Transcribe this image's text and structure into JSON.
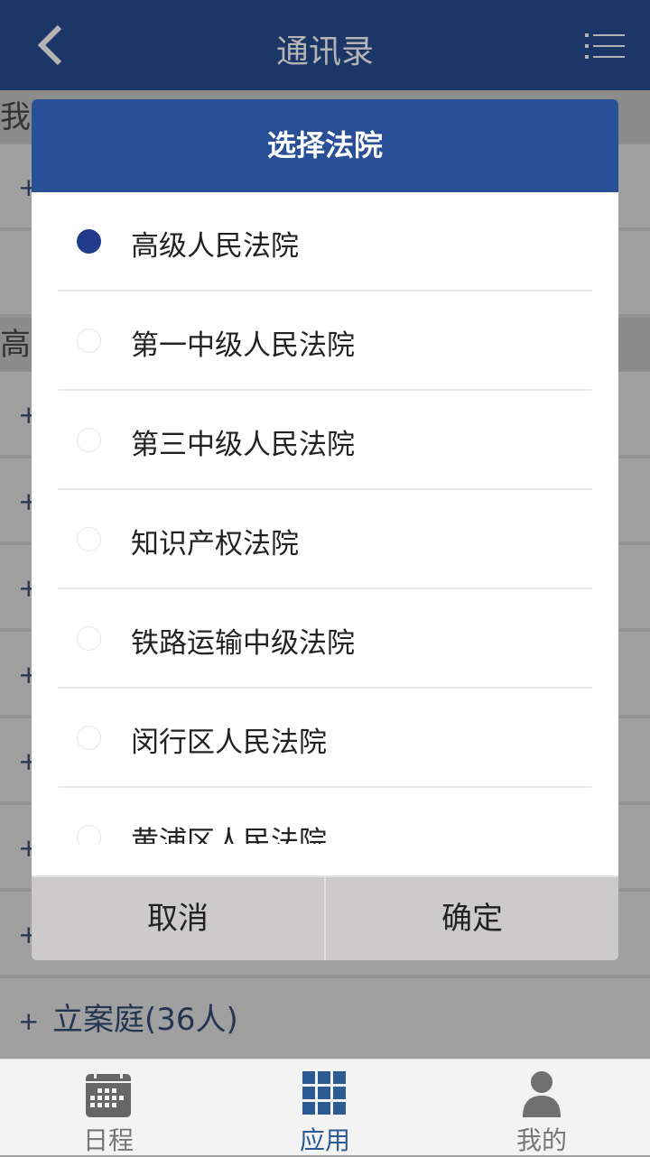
{
  "header": {
    "title": "通讯录",
    "back_icon": "chevron-left-icon",
    "menu_icon": "list-menu-icon"
  },
  "background_list": {
    "sections": [
      {
        "label": "我"
      },
      {
        "label": "高"
      }
    ],
    "last_row": "立案庭(36人)",
    "plus": "+"
  },
  "dialog": {
    "title": "选择法院",
    "options": [
      {
        "label": "高级人民法院",
        "selected": true
      },
      {
        "label": "第一中级人民法院",
        "selected": false
      },
      {
        "label": "第三中级人民法院",
        "selected": false
      },
      {
        "label": "知识产权法院",
        "selected": false
      },
      {
        "label": "铁路运输中级法院",
        "selected": false
      },
      {
        "label": "闵行区人民法院",
        "selected": false
      },
      {
        "label": "黄浦区人民法院",
        "selected": false
      }
    ],
    "cancel": "取消",
    "confirm": "确定"
  },
  "tabbar": {
    "items": [
      {
        "label": "日程",
        "icon": "calendar-icon",
        "active": false
      },
      {
        "label": "应用",
        "icon": "grid-icon",
        "active": true
      },
      {
        "label": "我的",
        "icon": "person-icon",
        "active": false
      }
    ]
  },
  "colors": {
    "header": "#1c3668",
    "dialog_header": "#294f96",
    "radio_selected": "#203a8c",
    "tab_active": "#2c5b93"
  }
}
